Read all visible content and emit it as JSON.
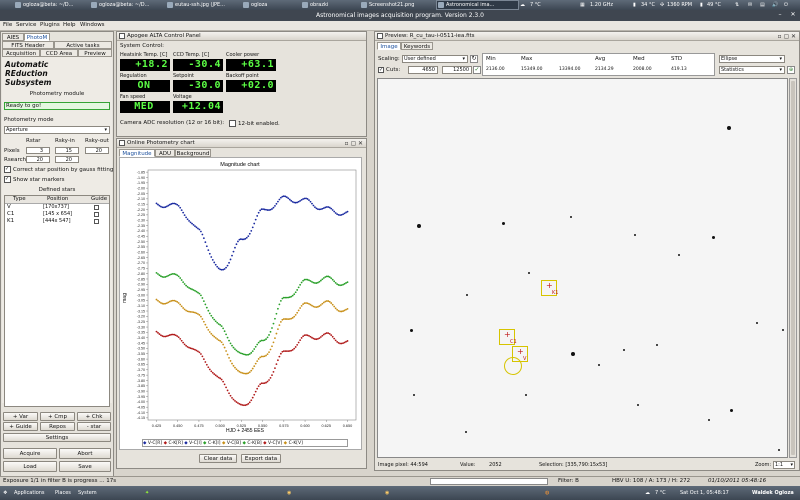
{
  "top_panel": {
    "tasks": [
      {
        "label": "ogloza@beta: ~/D..."
      },
      {
        "label": "ogloza@beta: ~/D..."
      },
      {
        "label": "eutau-ssh.jpg (JPE..."
      },
      {
        "label": "ogloza"
      },
      {
        "label": "obrazki"
      },
      {
        "label": "Screenshot21.png"
      },
      {
        "label": "Astronomical ima..."
      }
    ],
    "weather": "7 °C",
    "cpu": "1.20 GHz",
    "temp1": "34 °C",
    "fan": "1360 RPM",
    "temp2": "49 °C"
  },
  "window": {
    "title": "Astronomical images acquisition program. Version 2.3.0"
  },
  "menubar": [
    "File",
    "Service",
    "Plugins",
    "Help",
    "Windows"
  ],
  "left_panel": {
    "tabs_row1": [
      "AIES",
      "PhotoM"
    ],
    "tabs_row2": [
      "FITS Header",
      "Active tasks"
    ],
    "tabs_row3": [
      "Acquisition",
      "CCD Area",
      "Preview"
    ],
    "heading_lines": [
      "Automatic",
      "REduction",
      "Subsystem"
    ],
    "module_label": "Photometry module",
    "status": "Ready to go!",
    "mode_label": "Photometry mode",
    "mode_value": "Aperture",
    "col_headers": [
      "Rstar",
      "Rsky-in",
      "Rsky-out"
    ],
    "pixels_label": "Pixels",
    "pixels_values": [
      "3",
      "15",
      "20"
    ],
    "rsearch_label": "Rsearch",
    "rsearch_values": [
      "20",
      "20"
    ],
    "correct_label": "Correct star position by gauss fitting",
    "show_label": "Show star markers",
    "defined_label": "Defined stars",
    "table_headers": [
      "Type",
      "Position",
      "Guide"
    ],
    "stars": [
      {
        "type": "V",
        "position": "[170x737]"
      },
      {
        "type": "C1",
        "position": "[145 x 654]"
      },
      {
        "type": "K1",
        "position": "[444x 547]"
      }
    ],
    "buttons_row1": [
      "+ Var",
      "+ Cmp",
      "+ Chk"
    ],
    "buttons_row2": [
      "+ Guide",
      "Repos",
      "- star"
    ],
    "settings": "Settings",
    "acquire": "Acquire",
    "abort": "Abort",
    "load": "Load",
    "save": "Save"
  },
  "ccd": {
    "title": "Apogee ALTA Control Panel",
    "section": "System Control:",
    "labels": [
      "Heatsink Temp. [C]",
      "CCD Temp. [C]",
      "Cooler power",
      "Regulation",
      "Setpoint",
      "Backoff point",
      "Fan speed",
      "Voltage"
    ],
    "values": [
      "+18.2",
      "-30.4",
      "+63.1",
      "ON",
      "-30.0",
      "+02.0",
      "MED",
      "+12.04"
    ],
    "adc_label": "Camera ADC resolution (12 or 16 bit):",
    "adc_checkbox": "12-bit enabled."
  },
  "photchart": {
    "title": "Online Photometry chart",
    "tabs": [
      "Magnitude",
      "ADU",
      "Background"
    ],
    "chart_title": "Magnitude chart",
    "ylabel": "mag",
    "xlabel": "HJD + 2455 EES",
    "legend": [
      "V-C[R]",
      "C-K[R]",
      "V-C[I]",
      "C-K[I]",
      "V-C[B]",
      "C-K[B]",
      "V-C[V]",
      "C-K[V]"
    ],
    "clear": "Clear data",
    "export": "Export data"
  },
  "chart_data": {
    "type": "scatter",
    "title": "Magnitude chart",
    "xlabel": "HJD + 2455 EES",
    "ylabel": "mag",
    "xticks": [
      "0.425",
      "0.450",
      "0.475",
      "0.500",
      "0.525",
      "0.550",
      "0.575",
      "0.600",
      "0.625",
      "0.650"
    ],
    "yticks": [
      "-1.85",
      "-1.90",
      "-1.95",
      "-2.00",
      "-2.05",
      "-2.10",
      "-2.15",
      "-2.20",
      "-2.25",
      "-2.30",
      "-2.35",
      "-2.40",
      "-2.45",
      "-2.50",
      "-2.55",
      "-2.60",
      "-2.65",
      "-2.70",
      "-2.75",
      "-2.80",
      "-2.85",
      "-2.90",
      "-2.95",
      "-3.00",
      "-3.05",
      "-3.10",
      "-3.15",
      "-3.20",
      "-3.25",
      "-3.30",
      "-3.35",
      "-3.40",
      "-3.45",
      "-3.50",
      "-3.55",
      "-3.60",
      "-3.65",
      "-3.70",
      "-3.75",
      "-3.80",
      "-3.85",
      "-3.90",
      "-3.95",
      "-4.00",
      "-4.05",
      "-4.10",
      "-4.15"
    ],
    "series": [
      {
        "color": "#1a2aa0",
        "x": [
          0.425,
          0.45,
          0.475,
          0.5,
          0.525,
          0.55,
          0.575,
          0.6,
          0.625,
          0.65
        ],
        "y": [
          -2.15,
          -2.17,
          -2.4,
          -2.78,
          -2.5,
          -2.22,
          -2.1,
          -2.12,
          -2.2,
          -2.24
        ]
      },
      {
        "color": "#2aa02a",
        "x": [
          0.425,
          0.45,
          0.475,
          0.5,
          0.525,
          0.55,
          0.575,
          0.6,
          0.625,
          0.65
        ],
        "y": [
          -2.8,
          -2.83,
          -3.0,
          -3.3,
          -3.57,
          -3.45,
          -3.05,
          -2.88,
          -2.85,
          -2.9
        ]
      },
      {
        "color": "#c8901a",
        "x": [
          0.425,
          0.45,
          0.475,
          0.5,
          0.525,
          0.55,
          0.575,
          0.6,
          0.625,
          0.65
        ],
        "y": [
          -3.05,
          -3.08,
          -3.2,
          -3.45,
          -3.75,
          -3.6,
          -3.25,
          -3.1,
          -3.08,
          -3.15
        ]
      },
      {
        "color": "#b01a1a",
        "x": [
          0.425,
          0.45,
          0.475,
          0.5,
          0.525,
          0.55,
          0.575,
          0.6,
          0.625,
          0.65
        ],
        "y": [
          -3.35,
          -3.4,
          -3.55,
          -3.8,
          -4.05,
          -3.85,
          -3.55,
          -3.4,
          -3.38,
          -3.45
        ]
      }
    ]
  },
  "preview": {
    "title": "Preview: R_cu_tau-i-0511-iea.fits",
    "tabs": [
      "Image",
      "Keywords"
    ],
    "scaling_label": "Scaling:",
    "scaling_value": "User defined",
    "cuts_label": "Cuts:",
    "cut_low": "4650",
    "cut_high": "12500",
    "stats_headers": [
      "Min",
      "Max",
      "Avg",
      "Med",
      "STD"
    ],
    "stats_values": [
      "2136.00",
      "15349.00",
      "2134.29",
      "2008.00",
      "419.13"
    ],
    "stats_extra": "13394.00",
    "shape": "Ellipse",
    "statistics": "Statistics",
    "markers": [
      "K1",
      "C1",
      "V"
    ],
    "pixel_label": "Image pixel:",
    "pixel_value": "44:594",
    "value_label": "Value:",
    "value": "2052",
    "selection_label": "Selection:",
    "selection_value": "[335,790:15x53]",
    "zoom_label": "Zoom:",
    "zoom_value": "1:1"
  },
  "status": {
    "exposure": "Exposure 1/1 in filter B is progress ... 17s",
    "filter": "Filter: B",
    "hbv": "HBV U: 108 / A: 173 / H: 272",
    "datetime": "01/10/2011 05:48:16"
  },
  "bottom_panel": {
    "applications": "Applications",
    "places": "Places",
    "system": "System",
    "weather": "7 °C",
    "clock": "Sat Oct 1, 05:48:17",
    "user": "Waldek Ogloza"
  }
}
